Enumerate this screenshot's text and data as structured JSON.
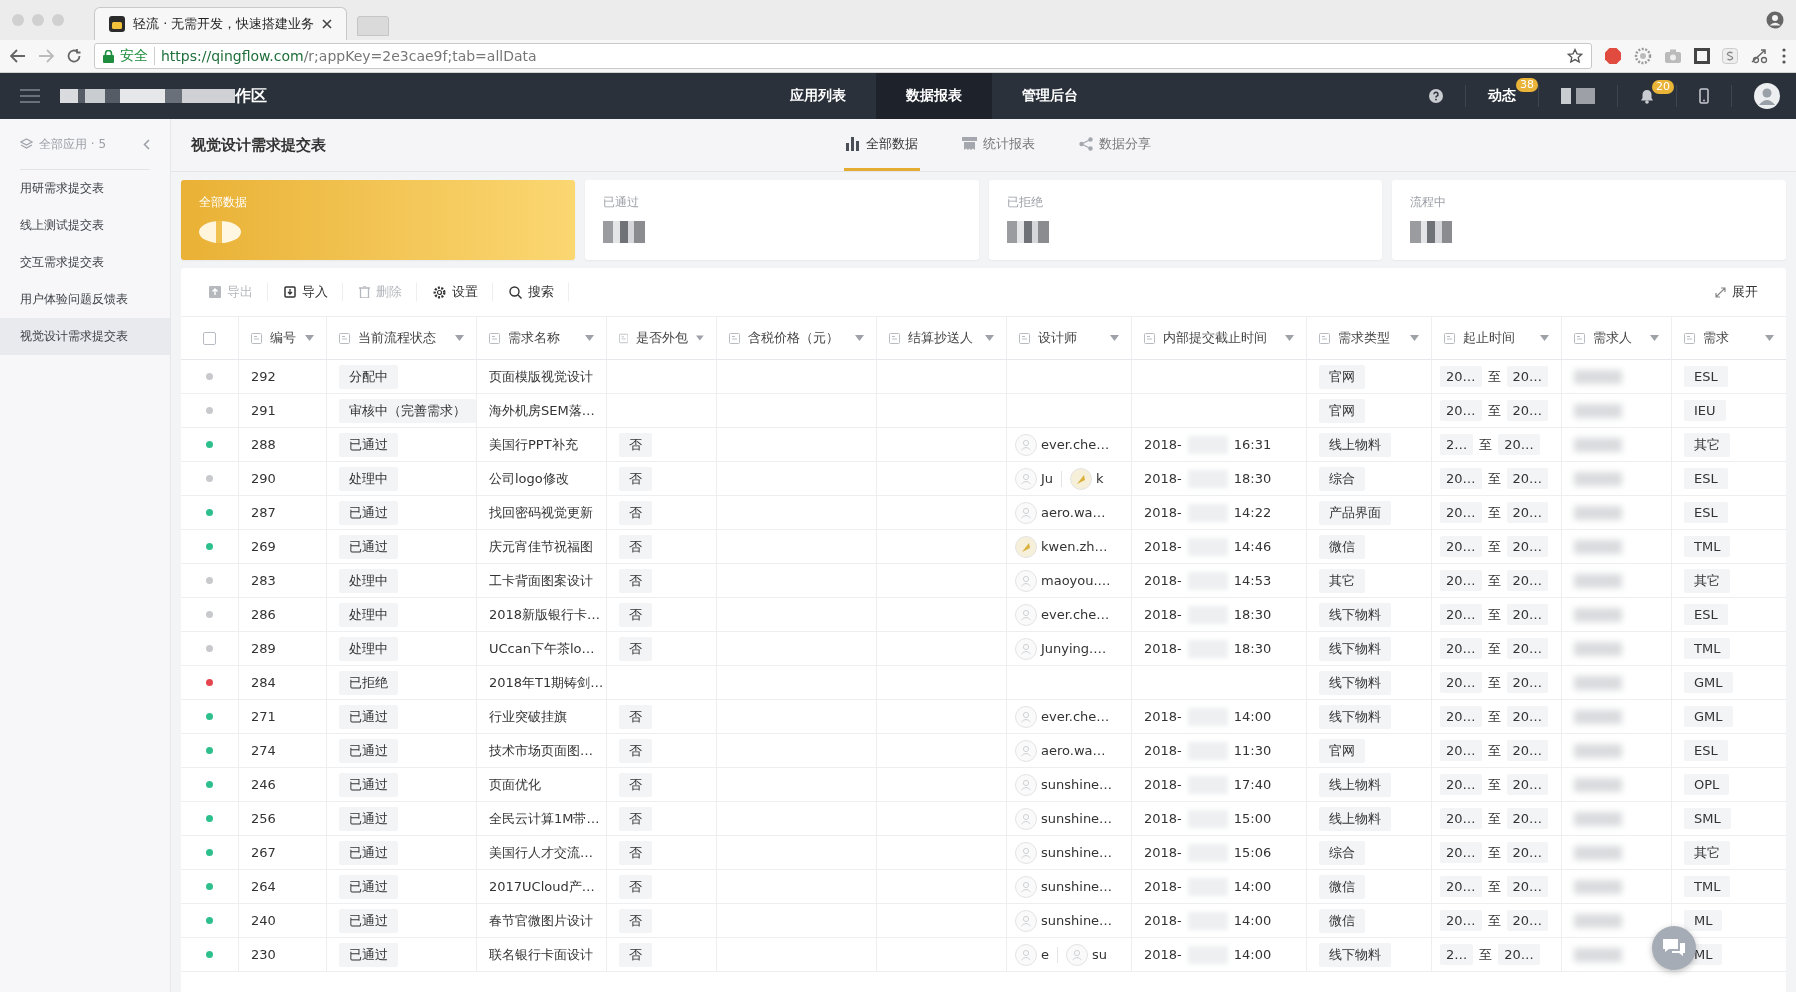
{
  "browser": {
    "tab_title": "轻流 · 无需开发，快速搭建业务",
    "secure_label": "安全",
    "url_host": "https://qingflow.com",
    "url_path": "/r;appKey=2e3cae9f;tab=allData"
  },
  "header": {
    "workspace_name": "作区",
    "nav": [
      {
        "label": "应用列表",
        "selected": false
      },
      {
        "label": "数据报表",
        "selected": true
      },
      {
        "label": "管理后台",
        "selected": false
      }
    ],
    "activity_label": "动态",
    "activity_badge": "38",
    "bell_badge": "20"
  },
  "sidebar": {
    "title": "全部应用 · 5",
    "items": [
      {
        "label": "用研需求提交表",
        "selected": false
      },
      {
        "label": "线上测试提交表",
        "selected": false
      },
      {
        "label": "交互需求提交表",
        "selected": false
      },
      {
        "label": "用户体验问题反馈表",
        "selected": false
      },
      {
        "label": "视觉设计需求提交表",
        "selected": true
      }
    ]
  },
  "page_title": "视觉设计需求提交表",
  "tabs": [
    {
      "label": "全部数据",
      "kind": "bars",
      "selected": true
    },
    {
      "label": "统计报表",
      "kind": "report",
      "selected": false
    },
    {
      "label": "数据分享",
      "kind": "share",
      "selected": false
    }
  ],
  "stat_cards": [
    {
      "label": "全部数据",
      "selected": true
    },
    {
      "label": "已通过",
      "selected": false
    },
    {
      "label": "已拒绝",
      "selected": false
    },
    {
      "label": "流程中",
      "selected": false
    }
  ],
  "toolbar": {
    "actions": [
      {
        "label": "导出",
        "kind": "export",
        "disabled": true
      },
      {
        "label": "导入",
        "kind": "import",
        "disabled": false
      },
      {
        "label": "删除",
        "kind": "delete",
        "disabled": true
      },
      {
        "label": "设置",
        "kind": "settings",
        "disabled": false
      },
      {
        "label": "搜索",
        "kind": "search",
        "disabled": false
      }
    ],
    "expand_label": "展开"
  },
  "table": {
    "select_all": {
      "checked": false
    },
    "columns": [
      {
        "label": "编号"
      },
      {
        "label": "当前流程状态"
      },
      {
        "label": "需求名称"
      },
      {
        "label": "是否外包"
      },
      {
        "label": "含税价格（元）"
      },
      {
        "label": "结算抄送人"
      },
      {
        "label": "设计师"
      },
      {
        "label": "内部提交截止时间"
      },
      {
        "label": "需求类型"
      },
      {
        "label": "起止时间"
      },
      {
        "label": "需求人"
      },
      {
        "label": "需求"
      }
    ],
    "rows": [
      {
        "id": "292",
        "color": "#c8c9cc",
        "status": "分配中",
        "name": "页面模版视觉设计",
        "type": "官网",
        "range": {
          "start": "20…",
          "sep": "至",
          "end": "20…"
        },
        "category": "ESL"
      },
      {
        "id": "291",
        "color": "#c8c9cc",
        "status": "审核中（完善需求）",
        "name": "海外机房SEM落…",
        "type": "官网",
        "range": {
          "start": "20…",
          "sep": "至",
          "end": "20…"
        },
        "category": "IEU"
      },
      {
        "id": "288",
        "color": "#2dbf8c",
        "status": "已通过",
        "name": "美国行PPT补充",
        "outsourced": "否",
        "designers": [
          {
            "name": "ever.che…",
            "photo": false
          }
        ],
        "deadline": {
          "date": "2018-",
          "time": "16:31"
        },
        "type": "线上物料",
        "range": {
          "start": "2…",
          "sep": "至",
          "end": "20…"
        },
        "category": "其它"
      },
      {
        "id": "290",
        "color": "#c8c9cc",
        "status": "处理中",
        "name": "公司logo修改",
        "outsourced": "否",
        "designers": [
          {
            "name": "Ju",
            "photo": false
          },
          {
            "name": "k",
            "photo": true
          }
        ],
        "deadline": {
          "date": "2018-",
          "time": "18:30"
        },
        "type": "综合",
        "range": {
          "start": "20…",
          "sep": "至",
          "end": "20…"
        },
        "category": "ESL"
      },
      {
        "id": "287",
        "color": "#2dbf8c",
        "status": "已通过",
        "name": "找回密码视觉更新",
        "outsourced": "否",
        "designers": [
          {
            "name": "aero.wa…",
            "photo": false
          }
        ],
        "deadline": {
          "date": "2018-",
          "time": "14:22"
        },
        "type": "产品界面",
        "range": {
          "start": "20…",
          "sep": "至",
          "end": "20…"
        },
        "category": "ESL"
      },
      {
        "id": "269",
        "color": "#2dbf8c",
        "status": "已通过",
        "name": "庆元宵佳节祝福图",
        "outsourced": "否",
        "designers": [
          {
            "name": "kwen.zh…",
            "photo": true
          }
        ],
        "deadline": {
          "date": "2018-",
          "time": "14:46"
        },
        "type": "微信",
        "range": {
          "start": "20…",
          "sep": "至",
          "end": "20…"
        },
        "category": "TML"
      },
      {
        "id": "283",
        "color": "#c8c9cc",
        "status": "处理中",
        "name": "工卡背面图案设计",
        "outsourced": "否",
        "designers": [
          {
            "name": "maoyou.…",
            "photo": false
          }
        ],
        "deadline": {
          "date": "2018-",
          "time": "14:53"
        },
        "type": "其它",
        "range": {
          "start": "20…",
          "sep": "至",
          "end": "20…"
        },
        "category": "其它"
      },
      {
        "id": "286",
        "color": "#c8c9cc",
        "status": "处理中",
        "name": "2018新版银行卡…",
        "outsourced": "否",
        "designers": [
          {
            "name": "ever.che…",
            "photo": false
          }
        ],
        "deadline": {
          "date": "2018-",
          "time": "18:30"
        },
        "type": "线下物料",
        "range": {
          "start": "20…",
          "sep": "至",
          "end": "20…"
        },
        "category": "ESL"
      },
      {
        "id": "289",
        "color": "#c8c9cc",
        "status": "处理中",
        "name": "UCcan下午茶lo…",
        "outsourced": "否",
        "designers": [
          {
            "name": "Junying.…",
            "photo": false
          }
        ],
        "deadline": {
          "date": "2018-",
          "time": "18:30"
        },
        "type": "线下物料",
        "range": {
          "start": "20…",
          "sep": "至",
          "end": "20…"
        },
        "category": "TML"
      },
      {
        "id": "284",
        "color": "#e5454f",
        "status": "已拒绝",
        "name": "2018年T1期铸剑…",
        "type": "线下物料",
        "range": {
          "start": "20…",
          "sep": "至",
          "end": "20…"
        },
        "category": "GML"
      },
      {
        "id": "271",
        "color": "#2dbf8c",
        "status": "已通过",
        "name": "行业突破挂旗",
        "outsourced": "否",
        "designers": [
          {
            "name": "ever.che…",
            "photo": false
          }
        ],
        "deadline": {
          "date": "2018-",
          "time": "14:00"
        },
        "type": "线下物料",
        "range": {
          "start": "20…",
          "sep": "至",
          "end": "20…"
        },
        "category": "GML"
      },
      {
        "id": "274",
        "color": "#2dbf8c",
        "status": "已通过",
        "name": "技术市场页面图…",
        "outsourced": "否",
        "designers": [
          {
            "name": "aero.wa…",
            "photo": false
          }
        ],
        "deadline": {
          "date": "2018-",
          "time": "11:30"
        },
        "type": "官网",
        "range": {
          "start": "20…",
          "sep": "至",
          "end": "20…"
        },
        "category": "ESL"
      },
      {
        "id": "246",
        "color": "#2dbf8c",
        "status": "已通过",
        "name": "页面优化",
        "outsourced": "否",
        "designers": [
          {
            "name": "sunshine…",
            "photo": false
          }
        ],
        "deadline": {
          "date": "2018-",
          "time": "17:40"
        },
        "type": "线上物料",
        "range": {
          "start": "20…",
          "sep": "至",
          "end": "20…"
        },
        "category": "OPL"
      },
      {
        "id": "256",
        "color": "#2dbf8c",
        "status": "已通过",
        "name": "全民云计算1M带…",
        "outsourced": "否",
        "designers": [
          {
            "name": "sunshine…",
            "photo": false
          }
        ],
        "deadline": {
          "date": "2018-",
          "time": "15:00"
        },
        "type": "线上物料",
        "range": {
          "start": "20…",
          "sep": "至",
          "end": "20…"
        },
        "category": "SML"
      },
      {
        "id": "267",
        "color": "#2dbf8c",
        "status": "已通过",
        "name": "美国行人才交流…",
        "outsourced": "否",
        "designers": [
          {
            "name": "sunshine…",
            "photo": false
          }
        ],
        "deadline": {
          "date": "2018-",
          "time": "15:06"
        },
        "type": "综合",
        "range": {
          "start": "20…",
          "sep": "至",
          "end": "20…"
        },
        "category": "其它"
      },
      {
        "id": "264",
        "color": "#2dbf8c",
        "status": "已通过",
        "name": "2017UCloud产…",
        "outsourced": "否",
        "designers": [
          {
            "name": "sunshine…",
            "photo": false
          }
        ],
        "deadline": {
          "date": "2018-",
          "time": "14:00"
        },
        "type": "微信",
        "range": {
          "start": "20…",
          "sep": "至",
          "end": "20…"
        },
        "category": "TML"
      },
      {
        "id": "240",
        "color": "#2dbf8c",
        "status": "已通过",
        "name": "春节官微图片设计",
        "outsourced": "否",
        "designers": [
          {
            "name": "sunshine…",
            "photo": false
          }
        ],
        "deadline": {
          "date": "2018-",
          "time": "14:00"
        },
        "type": "微信",
        "range": {
          "start": "20…",
          "sep": "至",
          "end": "20…"
        },
        "category": "ML"
      },
      {
        "id": "230",
        "color": "#2dbf8c",
        "status": "已通过",
        "name": "联名银行卡面设计",
        "outsourced": "否",
        "designers": [
          {
            "name": "e",
            "photo": false
          },
          {
            "name": "su",
            "photo": false
          }
        ],
        "deadline": {
          "date": "2018-",
          "time": "14:00"
        },
        "type": "线下物料",
        "range": {
          "start": "2…",
          "sep": "至",
          "end": "20…"
        },
        "category": "ML"
      }
    ]
  }
}
